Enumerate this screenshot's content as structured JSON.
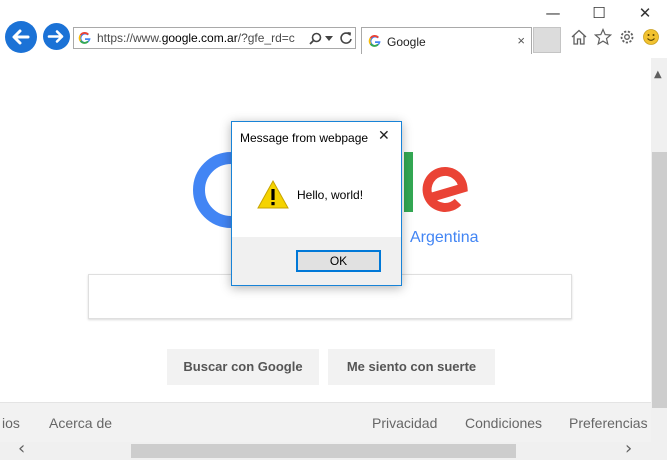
{
  "browser": {
    "address": {
      "prefix": "https://www.",
      "domain": "google.com.ar",
      "suffix": "/?gfe_rd=c"
    },
    "tab": {
      "title": "Google",
      "close_glyph": "×"
    },
    "window_controls": {
      "minimize": "—",
      "maximize": "☐",
      "close": "✕"
    },
    "icons": [
      "back-arrow-icon",
      "forward-arrow-icon",
      "google-favicon",
      "search-icon",
      "dropdown-icon",
      "refresh-icon",
      "home-icon",
      "favorites-star-icon",
      "settings-gear-icon",
      "feedback-smiley-icon"
    ]
  },
  "page": {
    "logo_subtitle": "Argentina",
    "buttons": {
      "search": "Buscar con Google",
      "lucky": "Me siento con suerte"
    },
    "footer": {
      "partial_left": "ios",
      "about": "Acerca de",
      "privacy": "Privacidad",
      "terms": "Condiciones",
      "preferences": "Preferencias"
    },
    "logo_colors": {
      "blue": "#4285f4",
      "red": "#ea4335",
      "yellow": "#fbbc05",
      "green": "#34a853"
    }
  },
  "dialog": {
    "title": "Message from webpage",
    "close_glyph": "✕",
    "message": "Hello, world!",
    "ok_label": "OK",
    "icon": "warning-icon"
  },
  "scrollbars": {
    "up": "▲",
    "left": "‹",
    "right": "›"
  }
}
